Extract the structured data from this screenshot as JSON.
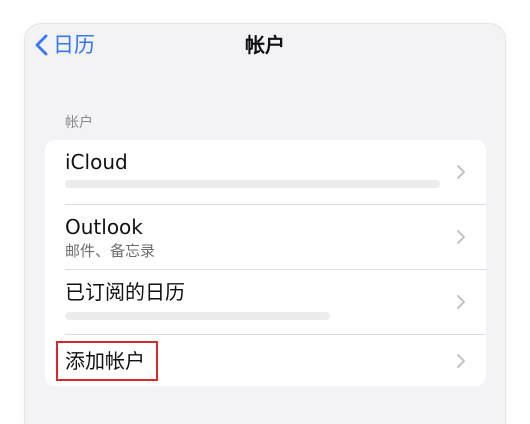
{
  "nav": {
    "back_label": "日历",
    "title": "帐户"
  },
  "section": {
    "header": "帐户"
  },
  "accounts": [
    {
      "title": "iCloud",
      "subtitle": ""
    },
    {
      "title": "Outlook",
      "subtitle": "邮件、备忘录"
    },
    {
      "title": "已订阅的日历",
      "subtitle": ""
    },
    {
      "title": "添加帐户",
      "subtitle": ""
    }
  ],
  "colors": {
    "accent": "#3478f6",
    "background": "#f2f2f7",
    "highlight": "#d62a2a"
  }
}
